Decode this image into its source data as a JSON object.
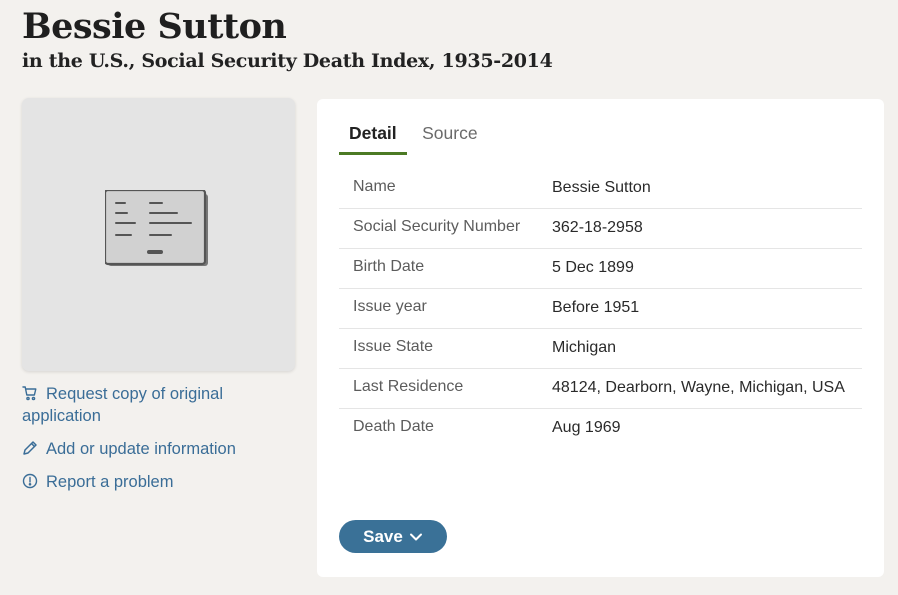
{
  "header": {
    "name": "Bessie Sutton",
    "collection": "in the U.S., Social Security Death Index, 1935-2014"
  },
  "image_card": {
    "icon": "document-card-icon"
  },
  "actions": [
    {
      "label": "Request copy of original application",
      "icon": "cart-icon"
    },
    {
      "label": "Add or update information",
      "icon": "pencil-icon"
    },
    {
      "label": "Report a problem",
      "icon": "alert-circle-icon"
    }
  ],
  "tabs": [
    {
      "label": "Detail",
      "active": true
    },
    {
      "label": "Source",
      "active": false
    }
  ],
  "details": [
    {
      "label": "Name",
      "value": "Bessie Sutton"
    },
    {
      "label": "Social Security Number",
      "value": "362-18-2958"
    },
    {
      "label": "Birth Date",
      "value": "5 Dec 1899"
    },
    {
      "label": "Issue year",
      "value": "Before 1951"
    },
    {
      "label": "Issue State",
      "value": "Michigan"
    },
    {
      "label": "Last Residence",
      "value": "48124, Dearborn, Wayne, Michigan, USA"
    },
    {
      "label": "Death Date",
      "value": "Aug 1969"
    }
  ],
  "save_button": {
    "label": "Save",
    "icon": "chevron-down-icon"
  },
  "colors": {
    "background": "#f3f1ee",
    "link": "#3a6d97",
    "tab_underline": "#4c7a24",
    "save_button": "#3a7197"
  }
}
